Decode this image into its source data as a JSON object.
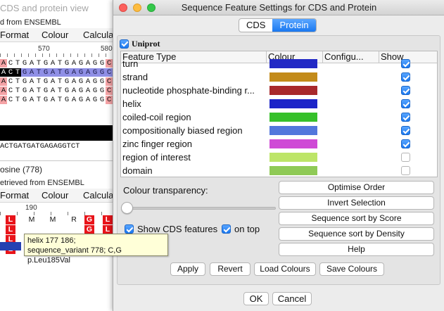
{
  "background_window": {
    "title": "CDS and protein view",
    "cds_source": "d from ENSEMBL",
    "menu_top": [
      "Format",
      "Colour",
      "Calcula"
    ],
    "ruler_top": [
      "570",
      "580"
    ],
    "cds_rows": [
      "ACTGATGATGAGAGGCT",
      "ACTGATGATGAGAGGCT",
      "ACTGATGATGAGAGGCT",
      "ACTGATGATGAGAGGCT",
      "ACTGATGATGAGAGGCT"
    ],
    "consensus_row": "ACTGATGATGAGAGGTCT",
    "feature_label": "osine (778)",
    "protein_source": "etrieved from ENSEMBL",
    "menu_bottom": [
      "Format",
      "Colour",
      "Calcula"
    ],
    "ruler_bottom": "190",
    "protein_row": [
      "L",
      "M",
      "M",
      "R",
      "G",
      "L"
    ]
  },
  "tooltip": {
    "line1": "helix 177 186;",
    "line2": "sequence_variant 778; C,G p.Leu185Val"
  },
  "dialog": {
    "title": "Sequence Feature Settings for CDS and Protein",
    "tabs": [
      {
        "label": "CDS",
        "active": false
      },
      {
        "label": "Protein",
        "active": true
      }
    ],
    "group": {
      "label": "Uniprot",
      "checked": true
    },
    "table": {
      "columns": [
        "Feature Type",
        "Colour",
        "Configu...",
        "Show"
      ],
      "rows": [
        {
          "name": "turn",
          "color": "#2229c5",
          "show": true
        },
        {
          "name": "strand",
          "color": "#c38b1a",
          "show": true
        },
        {
          "name": "nucleotide phosphate-binding r...",
          "color": "#a8292c",
          "show": true
        },
        {
          "name": "helix",
          "color": "#1c24c8",
          "show": true
        },
        {
          "name": "coiled-coil region",
          "color": "#36c02a",
          "show": true
        },
        {
          "name": "compositionally biased region",
          "color": "#5277dc",
          "show": true
        },
        {
          "name": "zinc finger region",
          "color": "#cf4ad6",
          "show": true
        },
        {
          "name": "region of interest",
          "color": "#bde568",
          "show": false
        },
        {
          "name": "domain",
          "color": "#8fca56",
          "show": false
        }
      ]
    },
    "transparency_label": "Colour transparency:",
    "transparency_value": 0,
    "show_cds_features": {
      "label": "Show CDS features",
      "checked": true
    },
    "on_top": {
      "label": "on top",
      "checked": true
    },
    "side_buttons": [
      "Optimise Order",
      "Invert Selection",
      "Sequence sort by Score",
      "Sequence sort by Density",
      "Help"
    ],
    "bottom_buttons": [
      "Apply",
      "Revert",
      "Load Colours",
      "Save Colours"
    ],
    "ok_label": "OK",
    "cancel_label": "Cancel"
  }
}
